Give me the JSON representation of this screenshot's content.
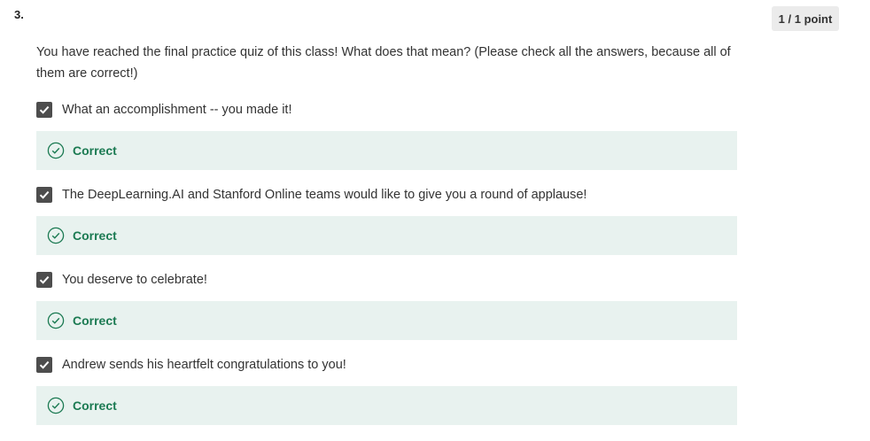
{
  "question": {
    "number": "3.",
    "points": "1 / 1 point",
    "text": "You have reached the final practice quiz of this class! What does that mean? (Please check all the answers, because all of them are correct!)"
  },
  "options": [
    {
      "label": "What an accomplishment -- you made it!",
      "checked": true,
      "feedback": "Correct"
    },
    {
      "label": "The DeepLearning.AI and Stanford Online teams would like to give you a round of applause!",
      "checked": true,
      "feedback": "Correct"
    },
    {
      "label": "You deserve to celebrate!",
      "checked": true,
      "feedback": "Correct"
    },
    {
      "label": "Andrew sends his heartfelt congratulations to you!",
      "checked": true,
      "feedback": "Correct"
    }
  ],
  "icons": {
    "checkbox": "checkmark-icon",
    "feedback": "check-circle-icon"
  },
  "colors": {
    "checkbox": "#4d4d4d",
    "feedback_bg": "#e8f2ef",
    "correct_text": "#1b7a52",
    "points_badge_bg": "#ebebeb"
  }
}
